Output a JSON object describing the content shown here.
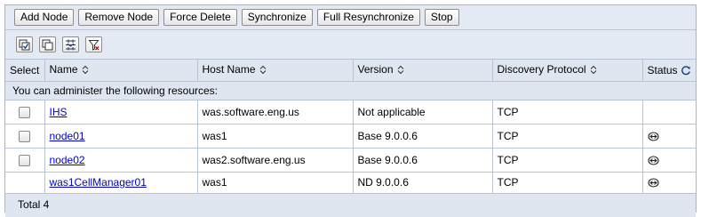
{
  "buttons": {
    "add_node": "Add Node",
    "remove_node": "Remove Node",
    "force_delete": "Force Delete",
    "synchronize": "Synchronize",
    "full_resync": "Full Resynchronize",
    "stop": "Stop"
  },
  "icon_toolbar": [
    "select-all-icon",
    "deselect-all-icon",
    "show-filter-icon",
    "clear-filter-icon"
  ],
  "table": {
    "headers": {
      "select": "Select",
      "name": "Name",
      "host": "Host Name",
      "version": "Version",
      "protocol": "Discovery Protocol",
      "status": "Status"
    },
    "message": "You can administer the following resources:",
    "rows": [
      {
        "name": "IHS",
        "host": "was.software.eng.us",
        "version": "Not applicable",
        "protocol": "TCP",
        "status": ""
      },
      {
        "name": "node01",
        "host": "was1",
        "version": "Base 9.0.0.6",
        "protocol": "TCP",
        "status": "synchronized-icon"
      },
      {
        "name": "node02",
        "host": "was2.software.eng.us",
        "version": "Base 9.0.0.6",
        "protocol": "TCP",
        "status": "synchronized-icon"
      },
      {
        "name": "was1CellManager01",
        "host": "was1",
        "version": "ND 9.0.0.6",
        "protocol": "TCP",
        "status": "synchronized-icon"
      }
    ],
    "total": "Total 4"
  },
  "colors": {
    "link": "#0000cc",
    "panel": "#e4eaf3",
    "border": "#b8c4d6"
  }
}
